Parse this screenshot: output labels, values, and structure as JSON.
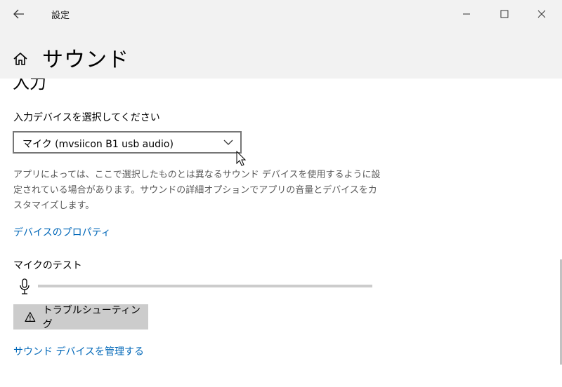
{
  "titlebar": {
    "app_title": "設定",
    "back_icon": "back-arrow-icon",
    "minimize_icon": "minimize-icon",
    "maximize_icon": "maximize-icon",
    "close_icon": "close-icon"
  },
  "header": {
    "home_icon": "home-icon",
    "page_title": "サウンド"
  },
  "input_section": {
    "heading": "入力",
    "select_label": "入力デバイスを選択してください",
    "selected_device": "マイク (mvsiicon B1 usb audio)",
    "description": "アプリによっては、ここで選択したものとは異なるサウンド デバイスを使用するように設定されている場合があります。サウンドの詳細オプションでアプリの音量とデバイスをカスタマイズします。",
    "device_properties_link": "デバイスのプロパティ",
    "mic_test_label": "マイクのテスト",
    "mic_level": 0,
    "troubleshoot_button": "トラブルシューティング",
    "manage_devices_link": "サウンド デバイスを管理する"
  },
  "colors": {
    "accent": "#0067b8",
    "titlebar_bg": "#f2f2f2",
    "button_bg": "#cccccc",
    "secondary_text": "#5a5a5a"
  }
}
